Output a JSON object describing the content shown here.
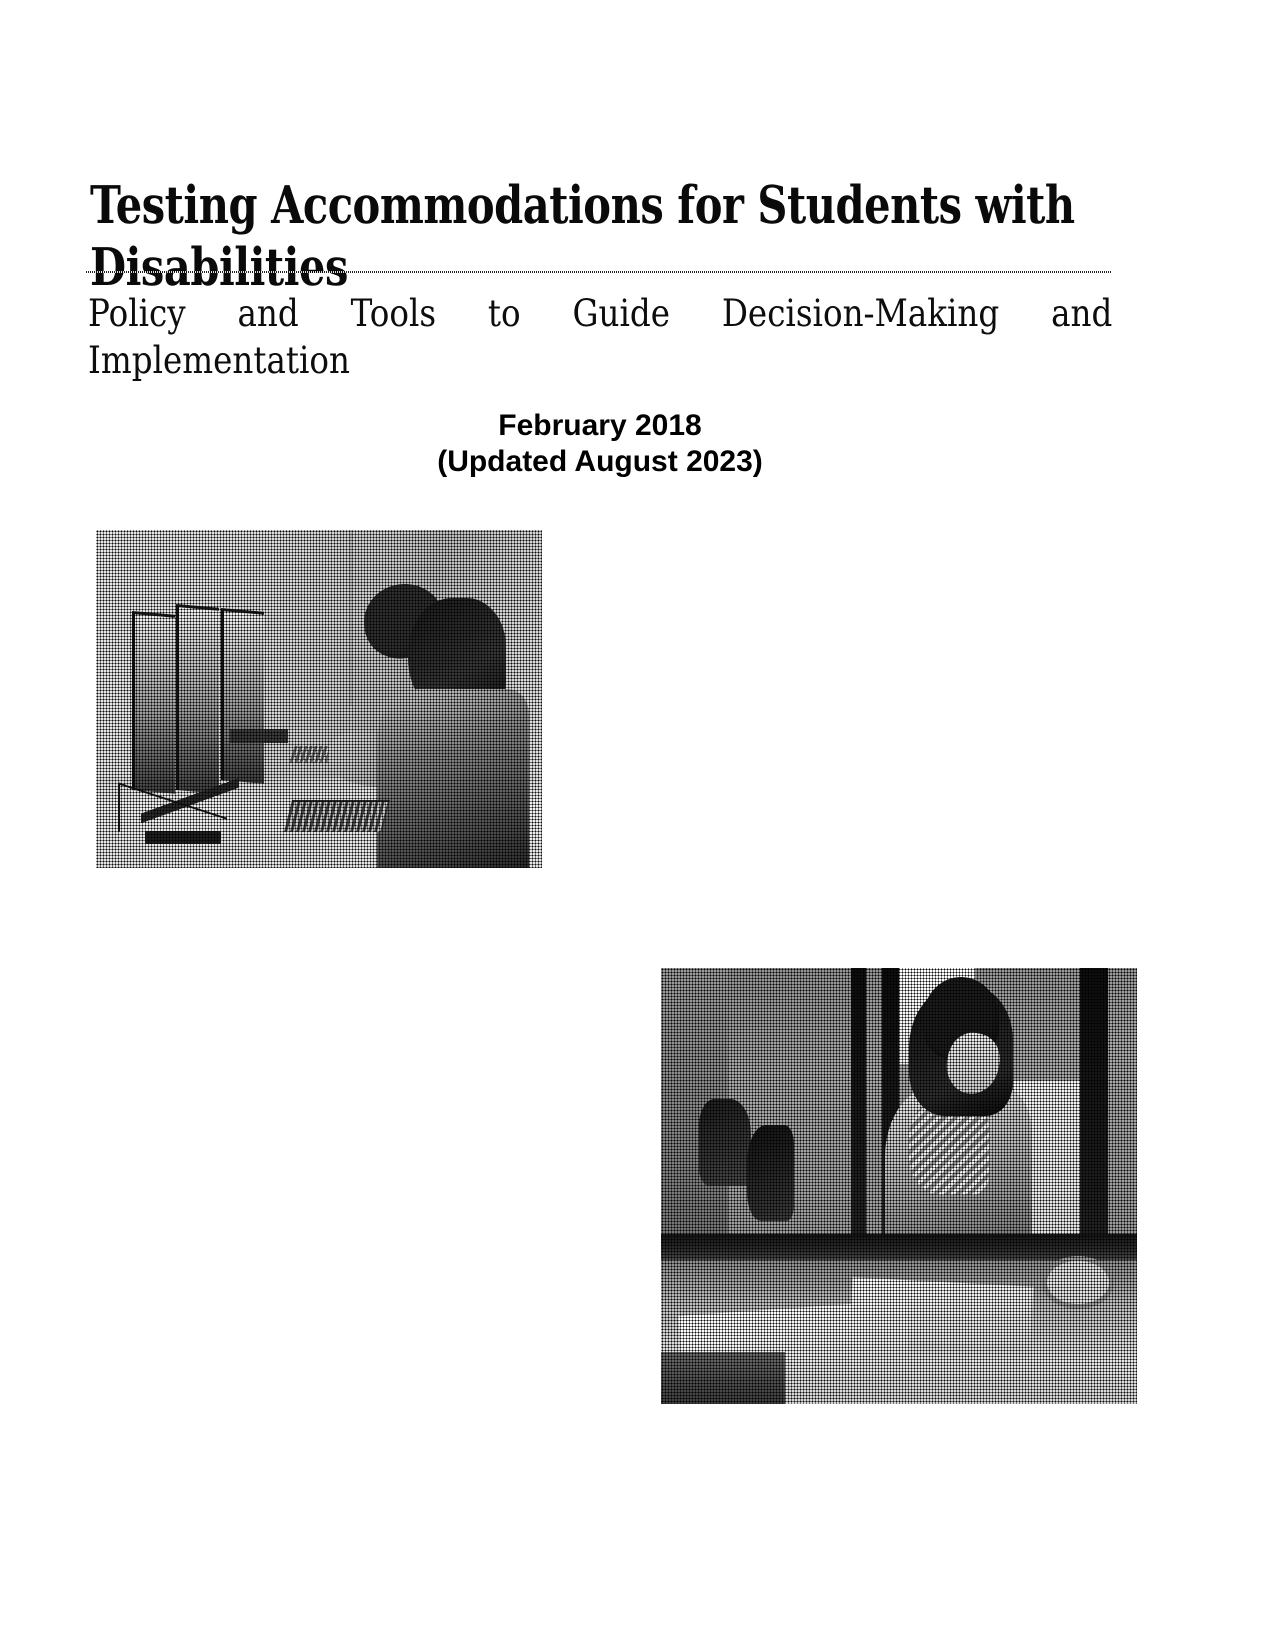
{
  "document": {
    "title": "Testing Accommodations for Students with Disabilities",
    "subtitle": "Policy and Tools to Guide Decision-Making and Implementation",
    "date_primary": "February 2018",
    "date_updated": "(Updated August 2023)"
  },
  "figures": {
    "photo_1": {
      "name": "student-at-computer-workstation",
      "description": "Halftone black-and-white photograph of a student seated at a desk working at a multi-monitor computer workstation with two keyboards"
    },
    "photo_2": {
      "name": "student-writing-at-desk",
      "description": "Halftone black-and-white photograph of a student seated at a desk near a window writing on papers"
    }
  },
  "colors": {
    "text": "#000000",
    "page_background": "#ffffff",
    "rule": "#000000"
  }
}
